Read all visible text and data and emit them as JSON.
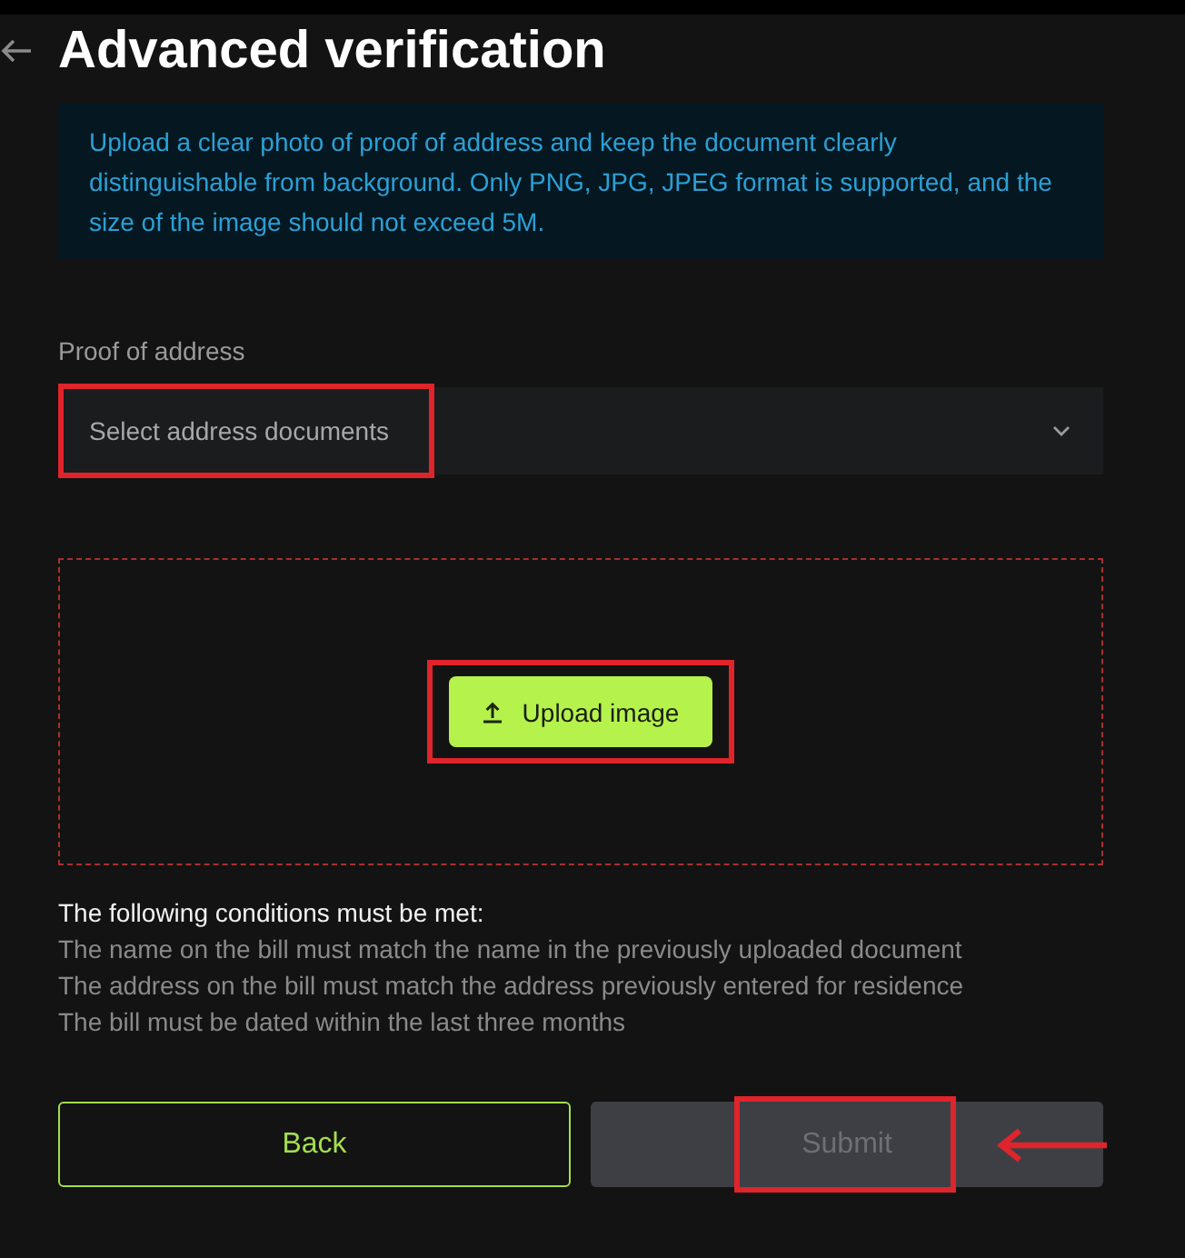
{
  "header": {
    "title": "Advanced verification"
  },
  "notice": {
    "text": "Upload a clear photo of proof of address and keep the document clearly distinguishable from background. Only PNG, JPG, JPEG format is supported, and the size of the image should not exceed 5M."
  },
  "address_field": {
    "label": "Proof of address",
    "placeholder": "Select address documents",
    "highlighted": true
  },
  "upload_area": {
    "button": {
      "label": "Upload image",
      "highlighted": true
    }
  },
  "conditions": {
    "heading": "The following conditions must be met:",
    "items": [
      "The name on the bill must match the name in the previously uploaded document",
      "The address on the bill must match the address previously entered for residence",
      "The bill must be dated within the last three months"
    ]
  },
  "buttons": [
    {
      "label": "Back",
      "kind": "secondary",
      "disabled": false,
      "highlighted": false,
      "pointer_arrow": false
    },
    {
      "label": "Submit",
      "kind": "primary",
      "disabled": true,
      "highlighted": true,
      "pointer_arrow": true
    }
  ]
}
